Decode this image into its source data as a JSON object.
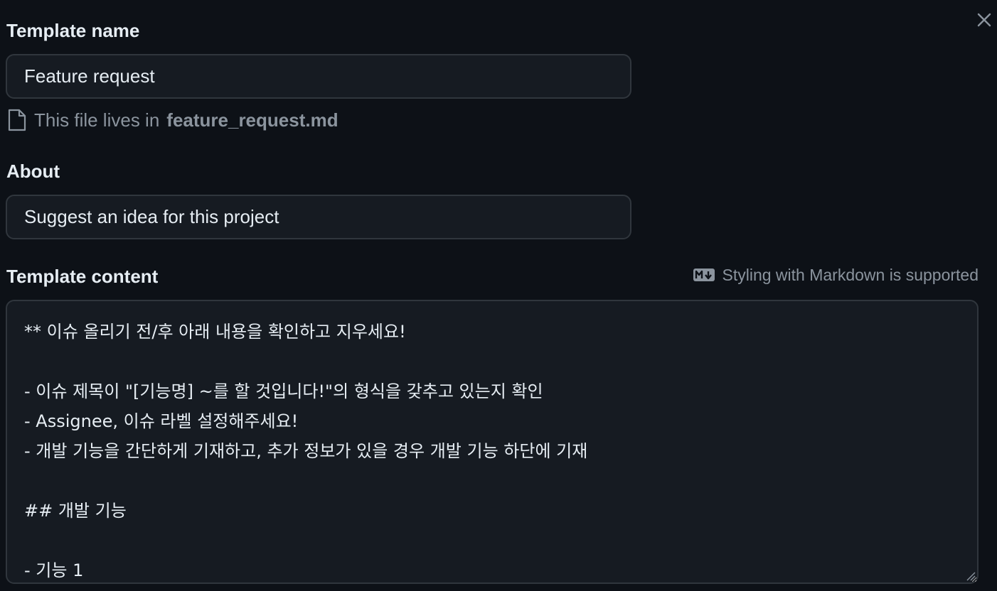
{
  "form": {
    "template_name": {
      "label": "Template name",
      "value": "Feature request"
    },
    "file_note": {
      "prefix": "This file lives in",
      "filename": "feature_request.md",
      "icon": "file-icon"
    },
    "about": {
      "label": "About",
      "value": "Suggest an idea for this project"
    },
    "template_content": {
      "label": "Template content",
      "markdown_hint": "Styling with Markdown is supported",
      "markdown_icon": "markdown-icon",
      "value": "** 이슈 올리기 전/후 아래 내용을 확인하고 지우세요!\n\n- 이슈 제목이 \"[기능명] ~를 할 것입니다!\"의 형식을 갖추고 있는지 확인\n- Assignee, 이슈 라벨 설정해주세요!\n- 개발 기능을 간단하게 기재하고, 추가 정보가 있을 경우 개발 기능 하단에 기재\n\n## 개발 기능\n\n- 기능 1"
    }
  },
  "close_icon": "close-icon",
  "colors": {
    "background": "#0d1117",
    "input_background": "#161b22",
    "border": "#30363d",
    "text": "#e6edf3",
    "muted": "#8b949e"
  }
}
